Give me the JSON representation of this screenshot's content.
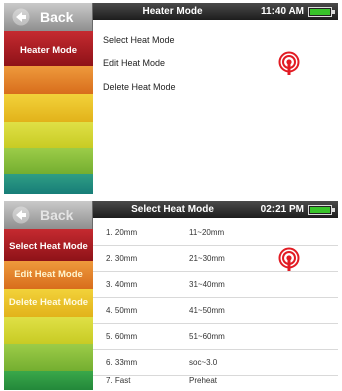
{
  "screen1": {
    "back_label": "Back",
    "sidebar_items": [
      {
        "label": "Heater Mode"
      }
    ],
    "header": {
      "title": "Heater Mode",
      "time": "11:40 AM"
    },
    "menu": [
      {
        "label": "Select Heat Mode"
      },
      {
        "label": "Edit Heat Mode"
      },
      {
        "label": "Delete Heat Mode"
      }
    ]
  },
  "screen2": {
    "back_label": "Back",
    "sidebar_items": [
      {
        "label": "Select Heat Mode"
      },
      {
        "label": "Edit Heat Mode"
      },
      {
        "label": "Delete Heat Mode"
      }
    ],
    "header": {
      "title": "Select Heat Mode",
      "time": "02:21 PM"
    },
    "rows": [
      {
        "name": "1. 20mm",
        "range": "11~20mm"
      },
      {
        "name": "2. 30mm",
        "range": "21~30mm"
      },
      {
        "name": "3. 40mm",
        "range": "31~40mm"
      },
      {
        "name": "4. 50mm",
        "range": "41~50mm"
      },
      {
        "name": "5. 60mm",
        "range": "51~60mm"
      },
      {
        "name": "6. 33mm",
        "range": "soc~3.0"
      },
      {
        "name": "7. Fast",
        "range": "Preheat"
      }
    ]
  },
  "colors": {
    "band_red": "#a81820",
    "band_orange": "#e07c22",
    "band_yellow": "#e8c21e",
    "band_yellowgreen": "#cfd22a",
    "band_lightgreen": "#86bd38",
    "band_green": "#2f9a3c",
    "band_teal": "#1b8f86",
    "header_dark": "#2a2a2a",
    "battery_green": "#38c42a",
    "heater_icon_red": "#e21b23"
  },
  "icons": [
    "back-arrow-icon",
    "heater-icon",
    "battery-icon"
  ],
  "battery_level": 0.9
}
